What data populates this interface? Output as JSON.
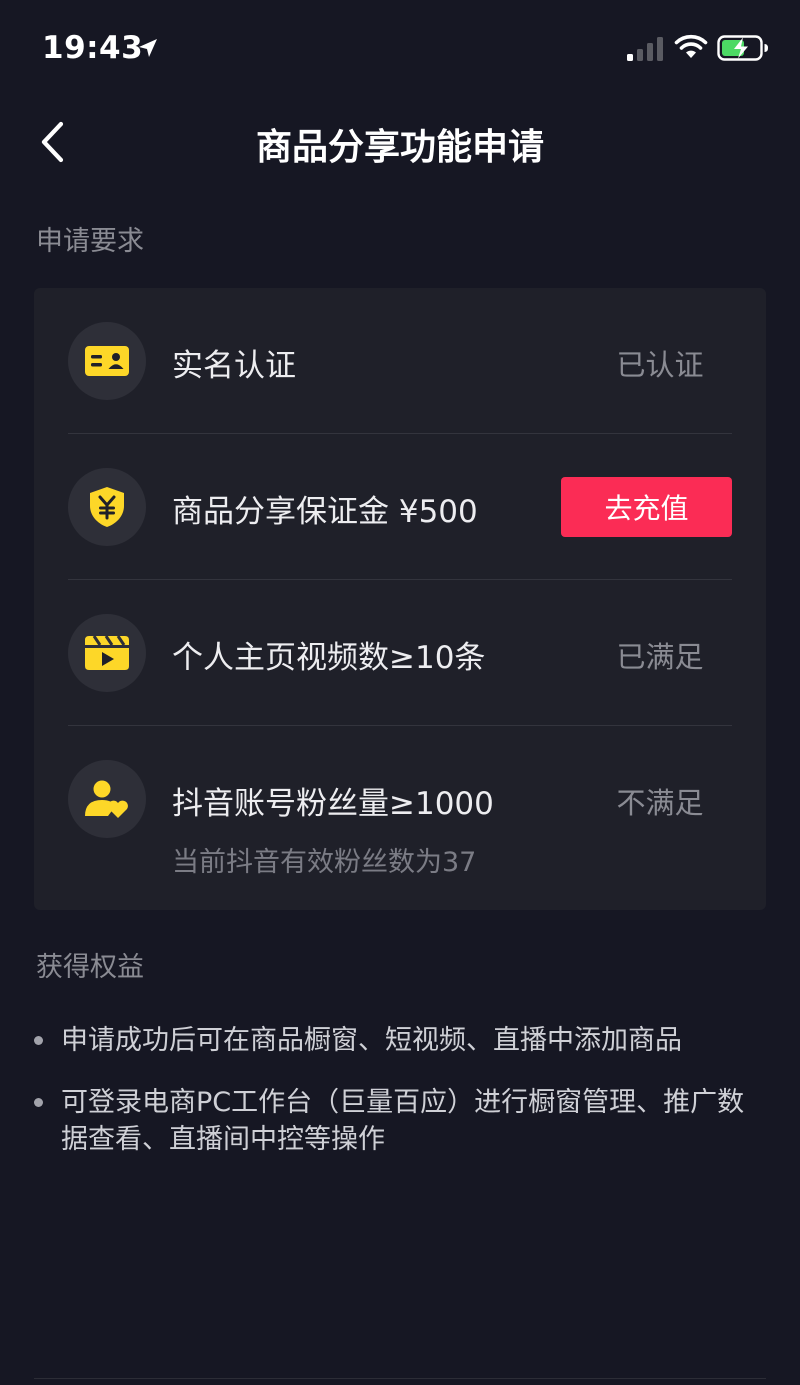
{
  "status_bar": {
    "time": "19:43"
  },
  "header": {
    "title": "商品分享功能申请"
  },
  "requirements": {
    "section_title": "申请要求",
    "items": [
      {
        "label": "实名认证",
        "status": "已认证",
        "icon": "id-card-icon"
      },
      {
        "label": "商品分享保证金 ¥500",
        "action_label": "去充值",
        "icon": "yuan-shield-icon"
      },
      {
        "label": "个人主页视频数≥10条",
        "status": "已满足",
        "icon": "video-clapper-icon"
      },
      {
        "label": "抖音账号粉丝量≥1000",
        "status": "不满足",
        "sub": "当前抖音有效粉丝数为37",
        "icon": "fans-heart-icon"
      }
    ]
  },
  "benefits": {
    "section_title": "获得权益",
    "items": [
      "申请成功后可在商品橱窗、短视频、直播中添加商品",
      "可登录电商PC工作台（巨量百应）进行橱窗管理、推广数据查看、直播间中控等操作"
    ]
  },
  "colors": {
    "background": "#161723",
    "card": "#1f2029",
    "accent_red": "#fb2c55",
    "icon_yellow": "#fdd728"
  }
}
